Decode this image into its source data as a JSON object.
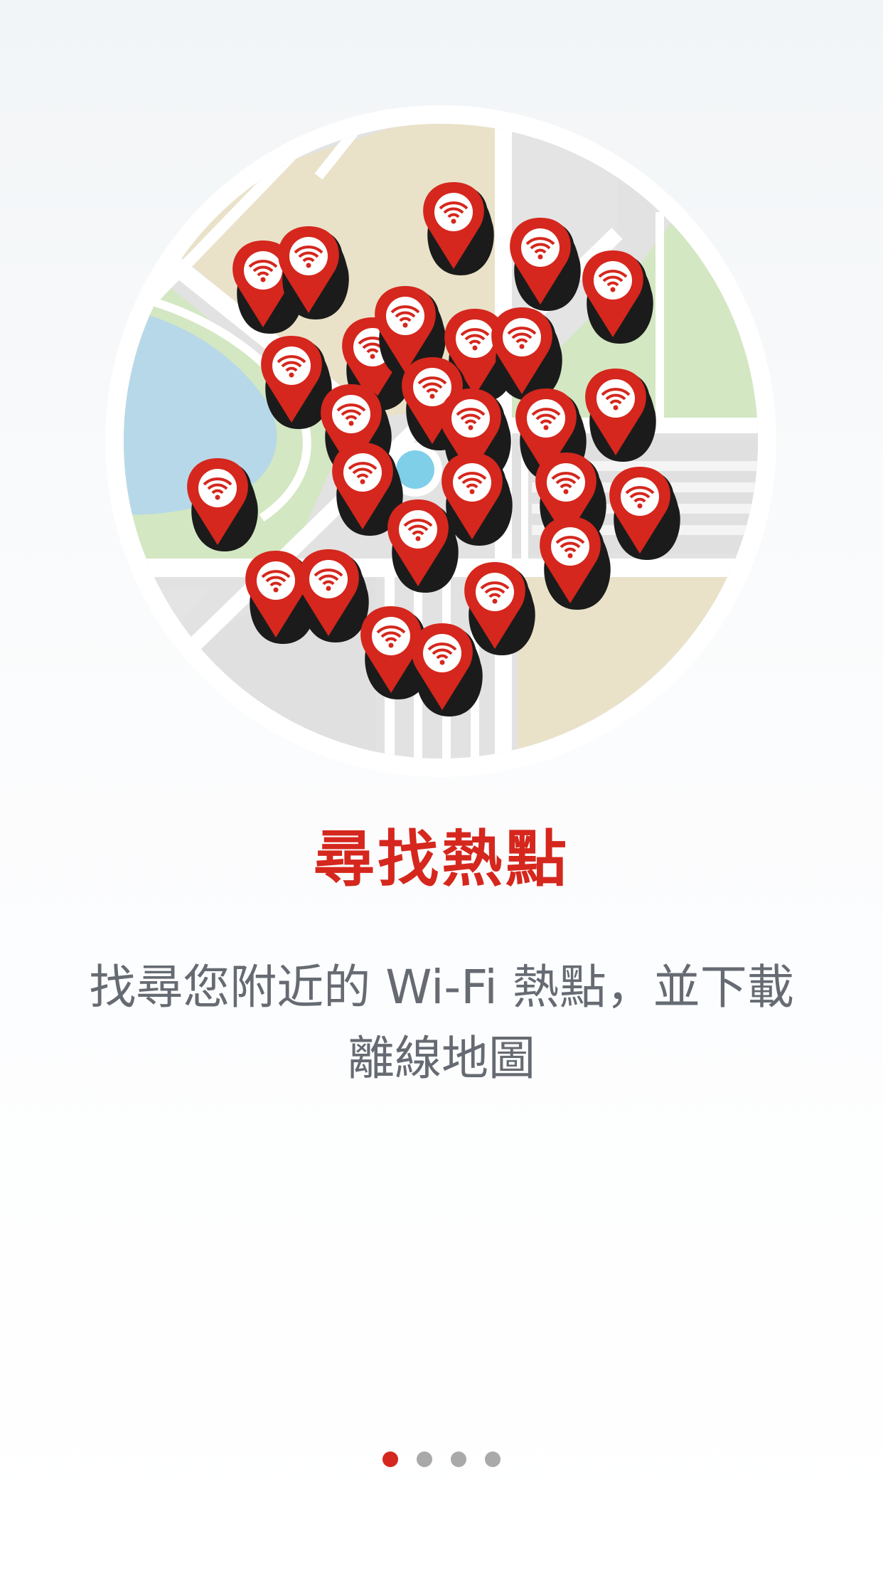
{
  "onboarding": {
    "title": "尋找熱點",
    "description": "找尋您附近的 Wi-Fi 熱點，並下載離線地圖"
  },
  "illustration": {
    "icon": "wifi-hotspot-map-icon",
    "pin_icon": "wifi-pin-icon",
    "location_icon": "current-location-icon"
  },
  "pager": {
    "page_count": 4,
    "current_page": 1
  },
  "colors": {
    "accent": "#d5271d",
    "text_secondary": "#666b73",
    "dot_inactive": "#a9a9a9",
    "location_dot": "#7fcfe8"
  }
}
